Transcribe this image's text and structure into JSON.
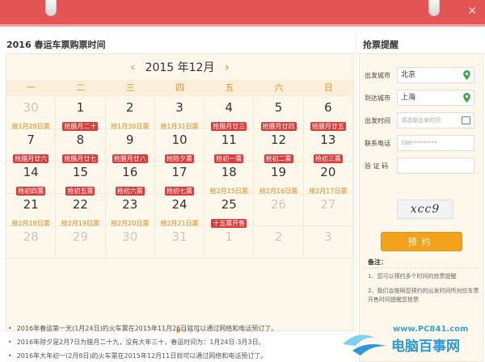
{
  "window": {
    "close_label": "✕"
  },
  "left": {
    "section_title": "2016 春运车票购票时间"
  },
  "calendar": {
    "month_label": "2015 年12月",
    "prev_icon": "chevron-left-icon",
    "next_icon": "chevron-right-icon",
    "weekdays": [
      "一",
      "二",
      "三",
      "四",
      "五",
      "六",
      "日"
    ],
    "cells": [
      {
        "n": "30",
        "t": "抢1月28日票",
        "dim": true,
        "red": false
      },
      {
        "n": "1",
        "t": "抢腊月二十",
        "dim": false,
        "red": true
      },
      {
        "n": "2",
        "t": "抢1月30日票",
        "dim": false,
        "red": false
      },
      {
        "n": "3",
        "t": "抢1月31日票",
        "dim": false,
        "red": false
      },
      {
        "n": "4",
        "t": "抢腊月廿三",
        "dim": false,
        "red": true
      },
      {
        "n": "5",
        "t": "抢腊月廿四",
        "dim": false,
        "red": true
      },
      {
        "n": "6",
        "t": "抢腊月廿五",
        "dim": false,
        "red": true
      },
      {
        "n": "7",
        "t": "抢腊月廿六",
        "dim": false,
        "red": true
      },
      {
        "n": "8",
        "t": "抢腊月廿七",
        "dim": false,
        "red": true
      },
      {
        "n": "9",
        "t": "抢腊月廿八",
        "dim": false,
        "red": true
      },
      {
        "n": "10",
        "t": "抢除夕票",
        "dim": false,
        "red": true
      },
      {
        "n": "11",
        "t": "抢初一票",
        "dim": false,
        "red": true
      },
      {
        "n": "12",
        "t": "抢初二票",
        "dim": false,
        "red": true
      },
      {
        "n": "13",
        "t": "抢初三票",
        "dim": false,
        "red": true
      },
      {
        "n": "14",
        "t": "抢初四票",
        "dim": false,
        "red": true
      },
      {
        "n": "15",
        "t": "抢初五票",
        "dim": false,
        "red": true
      },
      {
        "n": "16",
        "t": "抢初六票",
        "dim": false,
        "red": true
      },
      {
        "n": "17",
        "t": "抢初七票",
        "dim": false,
        "red": true
      },
      {
        "n": "18",
        "t": "抢2月15日票",
        "dim": false,
        "red": false
      },
      {
        "n": "19",
        "t": "抢2月16日票",
        "dim": false,
        "red": false
      },
      {
        "n": "20",
        "t": "抢2月17日票",
        "dim": false,
        "red": false
      },
      {
        "n": "21",
        "t": "抢2月18日票",
        "dim": false,
        "red": false
      },
      {
        "n": "22",
        "t": "抢2月19日票",
        "dim": false,
        "red": false
      },
      {
        "n": "23",
        "t": "抢2月20日票",
        "dim": false,
        "red": false
      },
      {
        "n": "24",
        "t": "抢2月21日票",
        "dim": false,
        "red": false
      },
      {
        "n": "25",
        "t": "十五票开售",
        "dim": false,
        "red": true
      },
      {
        "n": "26",
        "t": "",
        "dim": true,
        "red": false
      },
      {
        "n": "27",
        "t": "",
        "dim": true,
        "red": false
      },
      {
        "n": "28",
        "t": "",
        "dim": true,
        "red": false
      },
      {
        "n": "29",
        "t": "",
        "dim": true,
        "red": false
      },
      {
        "n": "30",
        "t": "",
        "dim": true,
        "red": false
      },
      {
        "n": "31",
        "t": "",
        "dim": true,
        "red": false
      },
      {
        "n": "1",
        "t": "",
        "dim": true,
        "red": false
      },
      {
        "n": "2",
        "t": "",
        "dim": true,
        "red": false
      },
      {
        "n": "3",
        "t": "",
        "dim": true,
        "red": false
      }
    ],
    "pager_active": 0,
    "pager_count": 4
  },
  "notes": [
    "2016年春运第一天(1月24日)的火车票在2015年11月26日就可以通过网络和电话预订了。",
    "2016年除夕是2月7日为腊月二十九，没有大年三十，春运时间为：1月24日-3月3日。",
    "2016年大年初一(2月8日)的火车票在2015年12月11日就可以通过网络和电话预订了。"
  ],
  "reminder": {
    "title": "抢票提醒",
    "from_label": "出发城市",
    "from_value": "北京",
    "to_label": "到达城市",
    "to_value": "上海",
    "time_label": "出发时间",
    "time_placeholder": "请选择出发时间",
    "phone_label": "联系电话",
    "phone_placeholder": "186*********",
    "code_label": "验 证 码",
    "captcha_text": "xcc9",
    "submit_label": "预约",
    "remark_title": "备注：",
    "remarks": [
      "1、您可以预约多个时间的抢票提醒",
      "2、我们会按照您预约的出发时间所对应车票开售时间提醒您抢票"
    ]
  },
  "watermark": {
    "url": "www.PC841.com",
    "name": "电脑百事网"
  },
  "colors": {
    "header": "#e45454",
    "accent": "#f4a21b",
    "tag_red": "#dd3b3b",
    "pin_green": "#39a845"
  }
}
